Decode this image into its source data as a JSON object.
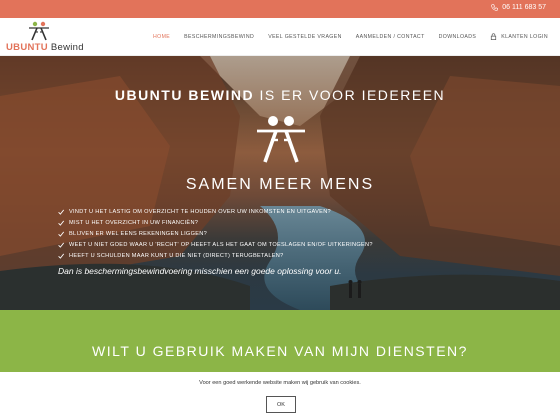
{
  "topbar": {
    "phone": "06 111 683 57",
    "phone_icon": "phone-icon"
  },
  "logo": {
    "brand_main": "UBUNTU",
    "brand_sub": " Bewind",
    "icon": "ubuntu-people-icon"
  },
  "nav": {
    "items": [
      "HOME",
      "BESCHERMINGSBEWIND",
      "VEEL GESTELDE VRAGEN",
      "AANMELDEN / CONTACT",
      "DOWNLOADS"
    ],
    "active_index": 0,
    "login_label": "KLANTEN LOGIN",
    "login_icon": "lock-icon"
  },
  "hero": {
    "title_strong": "UBUNTU BEWIND",
    "title_rest": " IS ER VOOR IEDEREEN",
    "slogan": "SAMEN MEER MENS",
    "checks": [
      "VINDT U HET LASTIG OM OVERZICHT TE HOUDEN OVER UW INKOMSTEN EN UITGAVEN?",
      "MIST U HET OVERZICHT IN UW FINANCIËN?",
      "BLIJVEN ER WEL EENS REKENINGEN LIGGEN?",
      "WEET U NIET GOED WAAR U 'RECHT' OP HEEFT ALS HET GAAT OM TOESLAGEN EN/OF UITKERINGEN?",
      "HEEFT U SCHULDEN MAAR KUNT U DIE NIET (DIRECT) TERUGBETALEN?"
    ],
    "note": "Dan is beschermingsbewindvoering misschien een goede oplossing voor u."
  },
  "cta": {
    "question": "WILT U GEBRUIK MAKEN VAN MIJN DIENSTEN?"
  },
  "cookie": {
    "message": "Voor een goed werkende website maken wij gebruik van cookies.",
    "ok_label": "OK"
  },
  "colors": {
    "accent": "#e2735a",
    "green": "#8cb547",
    "text": "#333333"
  }
}
